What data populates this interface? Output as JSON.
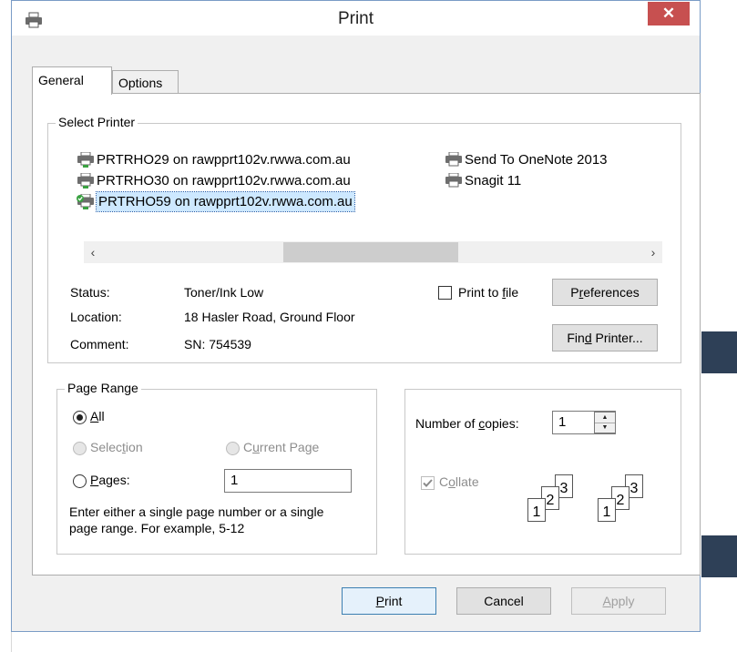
{
  "dialog": {
    "title": "Print",
    "close_glyph": "✕"
  },
  "tabs": [
    {
      "label": "General",
      "active": true
    },
    {
      "label": "Options",
      "active": false
    }
  ],
  "select_printer": {
    "group_title": "Select Printer",
    "printers": [
      {
        "name": "PRTRHO29 on rawpprt102v.rwwa.com.au",
        "icon": "network-printer-icon",
        "selected": false
      },
      {
        "name": "PRTRHO30 on rawpprt102v.rwwa.com.au",
        "icon": "network-printer-icon",
        "selected": false
      },
      {
        "name": "PRTRHO59 on rawpprt102v.rwwa.com.au",
        "icon": "default-network-printer-icon",
        "selected": true
      },
      {
        "name": "Send To OneNote 2013",
        "icon": "printer-icon",
        "selected": false
      },
      {
        "name": "Snagit 11",
        "icon": "printer-icon",
        "selected": false
      }
    ],
    "scroll_left": "‹",
    "scroll_right": "›",
    "status_label": "Status:",
    "status_value": "Toner/Ink Low",
    "location_label": "Location:",
    "location_value": "18 Hasler Road, Ground Floor",
    "comment_label": "Comment:",
    "comment_value": "SN: 754539",
    "print_to_file_pre": "Print to ",
    "print_to_file_u": "f",
    "print_to_file_post": "ile",
    "print_to_file_checked": false,
    "preferences_pre": "P",
    "preferences_u": "r",
    "preferences_post": "eferences",
    "find_printer_pre": "Fin",
    "find_printer_u": "d",
    "find_printer_post": " Printer..."
  },
  "page_range": {
    "group_title": "Page Range",
    "all_u": "A",
    "all_post": "ll",
    "selection_pre": "Selec",
    "selection_u": "t",
    "selection_post": "ion",
    "current_page_pre": "C",
    "current_page_u": "u",
    "current_page_post": "rrent Page",
    "pages_u": "P",
    "pages_post": "ages:",
    "pages_value": "1",
    "hint_line1": "Enter either a single page number or a single",
    "hint_line2": "page range.  For example, 5-12",
    "selected_option": "All"
  },
  "copies": {
    "label_pre": "Number of ",
    "label_u": "c",
    "label_post": "opies:",
    "value": "1",
    "collate_pre": "C",
    "collate_u": "o",
    "collate_post": "llate",
    "collate_checked": true,
    "collate_enabled": false,
    "page_numbers": [
      "1",
      "2",
      "3"
    ]
  },
  "buttons": {
    "print_u": "P",
    "print_post": "rint",
    "cancel": "Cancel",
    "apply_u": "A",
    "apply_post": "pply"
  },
  "colors": {
    "close": "#c75050",
    "selection_highlight": "#cde8ff",
    "dialog_border": "#7a9cc6",
    "background_strip": "#2e4057"
  }
}
